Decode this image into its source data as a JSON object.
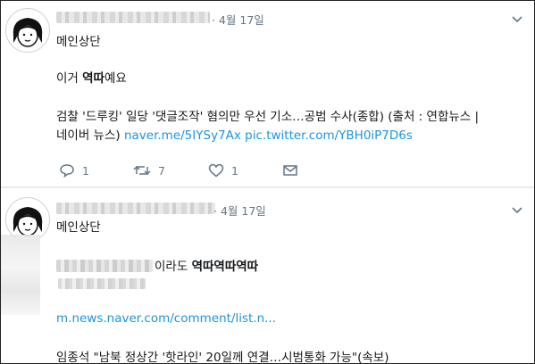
{
  "tweets": [
    {
      "date": "· 4월 17일",
      "line1": "메인상단",
      "line2_prefix": "이거 ",
      "line2_bold": "역따",
      "line2_suffix": "예요",
      "line3": "검찰 '드루킹' 일당 '댓글조작' 혐의만 우선 기소…공범 수사(종합) (출처 : 연합뉴스 |",
      "line4_prefix": "네이버 뉴스) ",
      "link1": "naver.me/5IYSy7Ax",
      "link2": "pic.twitter.com/YBH0iP7D6s",
      "reply_count": "1",
      "retweet_count": "7",
      "like_count": "1"
    },
    {
      "date": "· 4월 17일",
      "line1": "메인상단",
      "line2_suffix": "이라도 ",
      "line2_bold": "역따역따역따",
      "link1": "m.news.naver.com/comment/list.n...",
      "line5": "임종석 \"남북 정상간 '핫라인' 20일께 연결…시범통화 가능\"(속보)"
    }
  ],
  "icons": {
    "reply": "reply-icon",
    "retweet": "retweet-icon",
    "like": "heart-icon",
    "dm": "envelope-icon",
    "more": "chevron-down-icon",
    "avatar": "avatar-icon"
  },
  "colors": {
    "link": "#1b95e0",
    "meta": "#657786",
    "text": "#14171a"
  }
}
